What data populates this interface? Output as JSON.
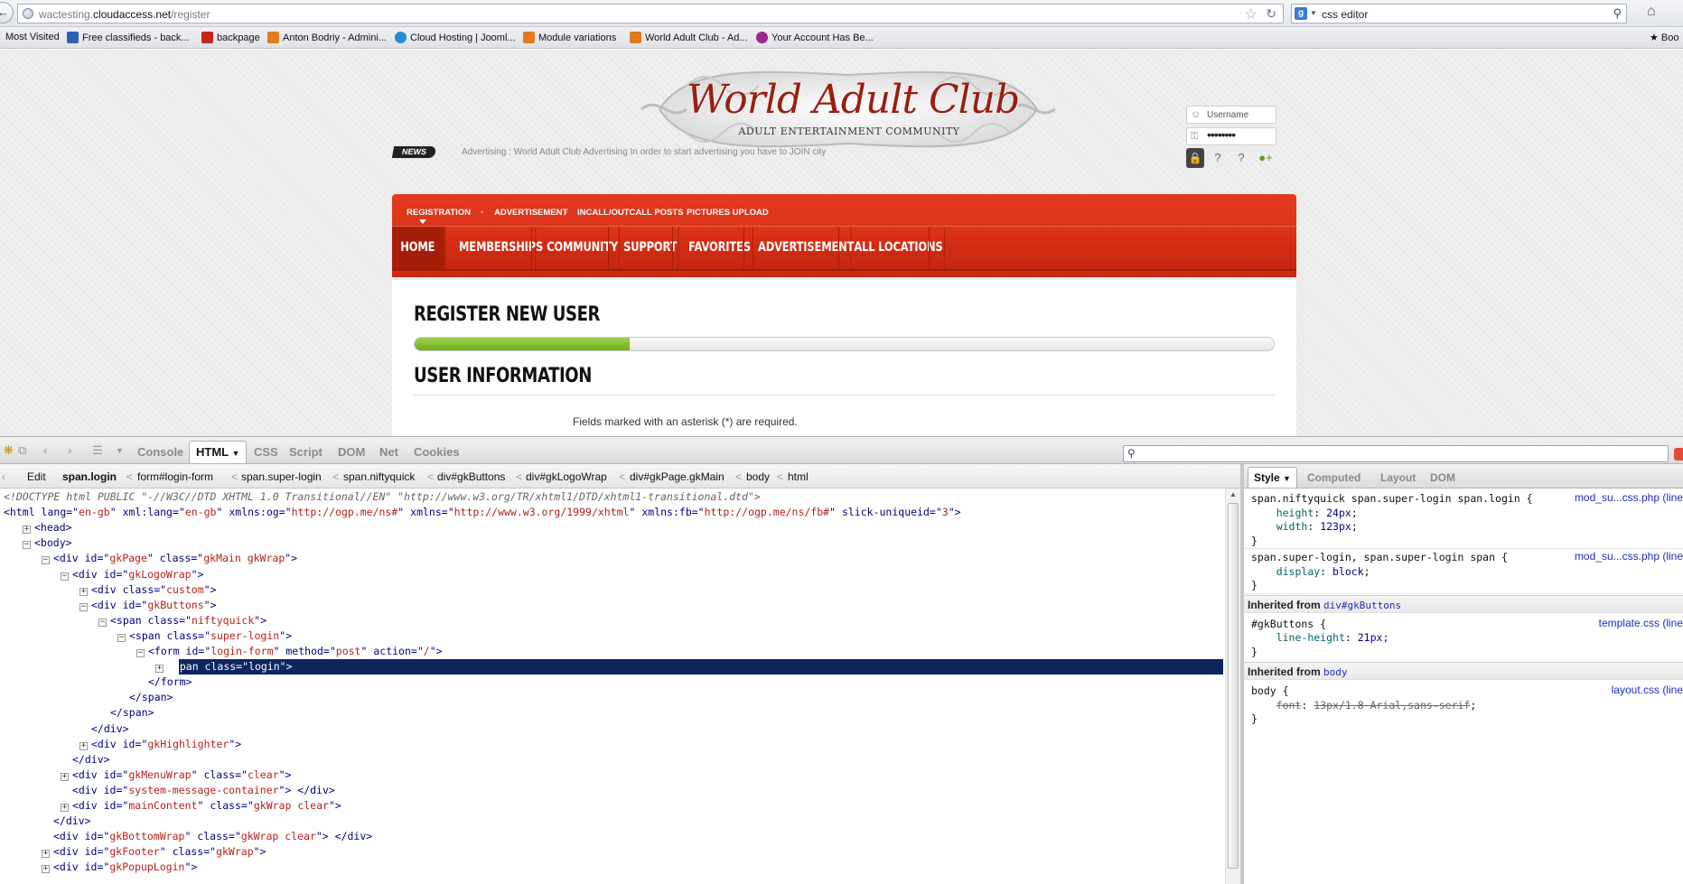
{
  "browser": {
    "url_prefix": "wactesting.",
    "url_domain": "cloudaccess.net",
    "url_path": "/register",
    "search_engine_badge": "g",
    "search_query": "css editor"
  },
  "bookmarks": [
    {
      "label": "Most Visited",
      "color": "#cfd6df"
    },
    {
      "label": "Free classifieds - back...",
      "color": "#2f5fb5"
    },
    {
      "label": "backpage",
      "color": "#c6261b"
    },
    {
      "label": "Anton Bodriy - Admini...",
      "color": "#e17b1c"
    },
    {
      "label": "Cloud Hosting | Jooml...",
      "color": "#2a8bd6"
    },
    {
      "label": "Module variations",
      "color": "#e17b1c"
    },
    {
      "label": "World Adult Club - Ad...",
      "color": "#e17b1c"
    },
    {
      "label": "Your Account Has Be...",
      "color": "#9b2a8a"
    }
  ],
  "bookmarks_right": "Boo",
  "site": {
    "logo_title": "World Adult Club",
    "logo_subtitle": "ADULT ENTERTAINMENT COMMUNITY",
    "login": {
      "username_placeholder": "Username",
      "password_mask": "••••••••"
    },
    "news_badge": "NEWS",
    "news_text": "Advertising : World Adult Club Advertising     In order to start advertising you have to JOIN city",
    "submenu": [
      "REGISTRATION",
      "ADVERTISEMENT",
      "INCALL/OUTCALL POSTS",
      "PICTURES UPLOAD"
    ],
    "menu": [
      "HOME",
      "MEMBERSHIPS",
      "COMMUNITY",
      "SUPPORT",
      "FAVORITES",
      "ADVERTISEMENT",
      "ALL LOCATIONS"
    ],
    "register_title": "REGISTER NEW USER",
    "progress_fraction": 0.25,
    "user_info_title": "USER INFORMATION",
    "required_note": "Fields marked with an asterisk (*) are required.",
    "accent": "#d52e15",
    "progress_color": "#86c034"
  },
  "firebug": {
    "tabs": [
      "Console",
      "HTML",
      "CSS",
      "Script",
      "DOM",
      "Net",
      "Cookies"
    ],
    "active_tab": "HTML",
    "breadcrumbs": [
      "Edit",
      "span.login",
      "form#login-form",
      "span.super-login",
      "span.niftyquick",
      "div#gkButtons",
      "div#gkLogoWrap",
      "div#gkPage.gkMain",
      "body",
      "html"
    ],
    "side_tabs": [
      "Style",
      "Computed",
      "Layout",
      "DOM"
    ],
    "tree": [
      {
        "indent": 0,
        "toggle": "",
        "html": "<span class=\"dt\">&lt;!DOCTYPE html PUBLIC \"-//W3C//DTD XHTML 1.0 Transitional//EN\" \"http://www.w3.org/TR/xhtml1/DTD/xhtml1-transitional.dtd\"&gt;</span>"
      },
      {
        "indent": 0,
        "toggle": "",
        "html": "&lt;html <span class=an>lang</span>=\"<span class=av>en-gb</span>\" <span class=an>xml:lang</span>=\"<span class=av>en-gb</span>\" <span class=an>xmlns:og</span>=\"<span class=av>http://ogp.me/ns#</span>\" <span class=an>xmlns</span>=\"<span class=av>http://www.w3.org/1999/xhtml</span>\" <span class=an>xmlns:fb</span>=\"<span class=av>http://ogp.me/ns/fb#</span>\" <span class=an>slick-uniqueid</span>=\"<span class=av>3</span>\"&gt;"
      },
      {
        "indent": 1,
        "toggle": "+",
        "html": "&lt;head&gt;"
      },
      {
        "indent": 1,
        "toggle": "-",
        "html": "&lt;body&gt;"
      },
      {
        "indent": 2,
        "toggle": "-",
        "html": "&lt;div <span class=an>id</span>=\"<span class=av>gkPage</span>\" <span class=an>class</span>=\"<span class=av>gkMain gkWrap</span>\"&gt;"
      },
      {
        "indent": 3,
        "toggle": "-",
        "html": "&lt;div <span class=an>id</span>=\"<span class=av>gkLogoWrap</span>\"&gt;"
      },
      {
        "indent": 4,
        "toggle": "+",
        "html": "&lt;div <span class=an>class</span>=\"<span class=av>custom</span>\"&gt;"
      },
      {
        "indent": 4,
        "toggle": "-",
        "html": "&lt;div <span class=an>id</span>=\"<span class=av>gkButtons</span>\"&gt;"
      },
      {
        "indent": 5,
        "toggle": "-",
        "html": "&lt;span <span class=an>class</span>=\"<span class=av>niftyquick</span>\"&gt;"
      },
      {
        "indent": 6,
        "toggle": "-",
        "html": "&lt;span <span class=an>class</span>=\"<span class=av>super-login</span>\"&gt;"
      },
      {
        "indent": 7,
        "toggle": "-",
        "html": "&lt;form <span class=an>id</span>=\"<span class=av>login-form</span>\" <span class=an>method</span>=\"<span class=av>post</span>\" <span class=an>action</span>=\"<span class=av>/</span>\"&gt;"
      },
      {
        "indent": 8,
        "toggle": "+",
        "html": "&lt;span <span class=an>class</span>=\"<span class=av>login</span>\"&gt;",
        "selected": true
      },
      {
        "indent": 7,
        "toggle": "",
        "html": "&lt;/form&gt;"
      },
      {
        "indent": 6,
        "toggle": "",
        "html": "&lt;/span&gt;"
      },
      {
        "indent": 5,
        "toggle": "",
        "html": "&lt;/span&gt;"
      },
      {
        "indent": 4,
        "toggle": "",
        "html": "&lt;/div&gt;"
      },
      {
        "indent": 4,
        "toggle": "+",
        "html": "&lt;div <span class=an>id</span>=\"<span class=av>gkHighlighter</span>\"&gt;"
      },
      {
        "indent": 3,
        "toggle": "",
        "html": "&lt;/div&gt;"
      },
      {
        "indent": 3,
        "toggle": "+",
        "html": "&lt;div <span class=an>id</span>=\"<span class=av>gkMenuWrap</span>\" <span class=an>class</span>=\"<span class=av>clear</span>\"&gt;"
      },
      {
        "indent": 3,
        "toggle": "",
        "html": "&lt;div <span class=an>id</span>=\"<span class=av>system-message-container</span>\"&gt; &lt;/div&gt;"
      },
      {
        "indent": 3,
        "toggle": "+",
        "html": "&lt;div <span class=an>id</span>=\"<span class=av>mainContent</span>\" <span class=an>class</span>=\"<span class=av>gkWrap clear</span>\"&gt;"
      },
      {
        "indent": 2,
        "toggle": "",
        "html": "&lt;/div&gt;"
      },
      {
        "indent": 2,
        "toggle": "",
        "html": "&lt;div <span class=an>id</span>=\"<span class=av>gkBottomWrap</span>\" <span class=an>class</span>=\"<span class=av>gkWrap clear</span>\"&gt; &lt;/div&gt;"
      },
      {
        "indent": 2,
        "toggle": "+",
        "html": "&lt;div <span class=an>id</span>=\"<span class=av>gkFooter</span>\" <span class=an>class</span>=\"<span class=av>gkWrap</span>\"&gt;"
      },
      {
        "indent": 2,
        "toggle": "+",
        "html": "&lt;div <span class=an>id</span>=\"<span class=av>gkPopupLogin</span>\"&gt;"
      }
    ],
    "rules": [
      {
        "selector": "span.niftyquick span.super-login span.login {",
        "source": "mod_su...css.php (line",
        "props": [
          [
            "height",
            "24px"
          ],
          [
            "width",
            "123px"
          ]
        ]
      },
      {
        "selector": "span.super-login, span.super-login span {",
        "source": "mod_su...css.php (line",
        "props": [
          [
            "display",
            "block"
          ]
        ]
      }
    ],
    "inherited": [
      {
        "label": "Inherited from ",
        "from": "div#gkButtons",
        "selector": "#gkButtons {",
        "source": "template.css (line",
        "props": [
          [
            "line-height",
            "21px"
          ]
        ],
        "strike": false
      },
      {
        "label": "Inherited from ",
        "from": "body",
        "selector": "body {",
        "source": "layout.css (line",
        "props": [
          [
            "font",
            "13px/1.8 Arial,sans-serif"
          ]
        ],
        "strike": true
      }
    ]
  }
}
